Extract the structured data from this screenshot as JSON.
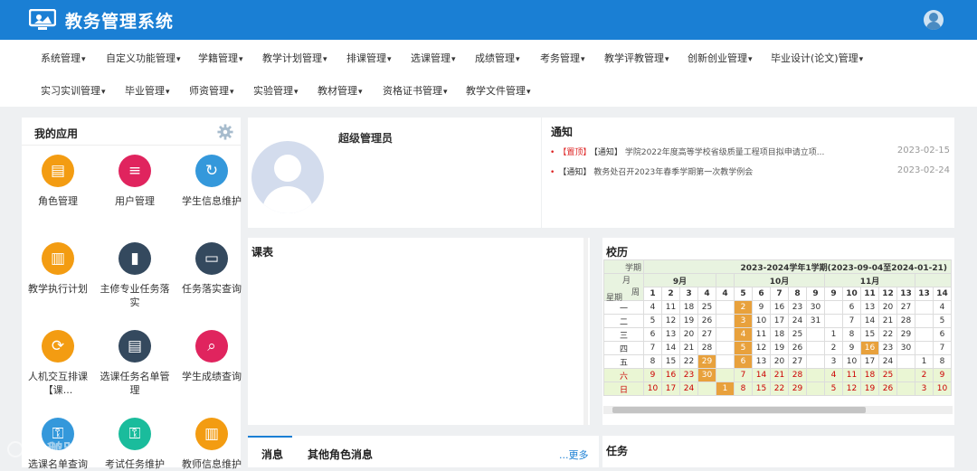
{
  "header": {
    "title": "教务管理系统"
  },
  "menu_row1": [
    "系统管理",
    "自定义功能管理",
    "学籍管理",
    "教学计划管理",
    "排课管理",
    "选课管理",
    "成绩管理",
    "考务管理",
    "教学评教管理",
    "创新创业管理",
    "毕业设计(论文)管理"
  ],
  "menu_row2": [
    "实习实训管理",
    "毕业管理",
    "师资管理",
    "实验管理",
    "教材管理",
    "资格证书管理",
    "教学文件管理"
  ],
  "apps": {
    "title": "我的应用",
    "items": [
      {
        "label": "角色管理",
        "color": "#f39c12",
        "icon": "clipboard-icon"
      },
      {
        "label": "用户管理",
        "color": "#e0245e",
        "icon": "stack-icon"
      },
      {
        "label": "学生信息维护",
        "color": "#3498db",
        "icon": "refresh-user-icon"
      },
      {
        "label": "教学执行计划",
        "color": "#f39c12",
        "icon": "book-icon"
      },
      {
        "label": "主修专业任务落实",
        "color": "#34495e",
        "icon": "bookmark-icon"
      },
      {
        "label": "任务落实查询",
        "color": "#34495e",
        "icon": "camera-icon"
      },
      {
        "label": "人机交互排课【课...",
        "color": "#f39c12",
        "icon": "cycle-icon"
      },
      {
        "label": "选课任务名单管理",
        "color": "#34495e",
        "icon": "document-icon"
      },
      {
        "label": "学生成绩查询",
        "color": "#e0245e",
        "icon": "search-doc-icon"
      },
      {
        "label": "选课名单查询",
        "color": "#3498db",
        "icon": "key-icon"
      },
      {
        "label": "考试任务维护",
        "color": "#1abc9c",
        "icon": "key-icon"
      },
      {
        "label": "教师信息维护",
        "color": "#f39c12",
        "icon": "book-icon"
      }
    ]
  },
  "profile": {
    "name": "超级管理员"
  },
  "notices": {
    "title": "通知",
    "items": [
      {
        "top_tag": "【置顶】",
        "type": "【通知】",
        "title": "学院2022年度高等学校省级质量工程项目拟申请立项...",
        "date": "2023-02-15"
      },
      {
        "top_tag": "",
        "type": "【通知】",
        "title": "教务处召开2023年春季学期第一次教学例会",
        "date": "2023-02-24"
      }
    ]
  },
  "schedule": {
    "title": "课表"
  },
  "calendar": {
    "title": "校历",
    "term": "2023-2024学年1学期(2023-09-04至2024-01-21)",
    "corner": {
      "term": "学期",
      "month": "月",
      "week": "周",
      "weekday": "星期"
    },
    "months": [
      "9月",
      "10月",
      "11月"
    ],
    "weeks": [
      "1",
      "2",
      "3",
      "4",
      "4",
      "5",
      "6",
      "7",
      "8",
      "9",
      "9",
      "10",
      "11",
      "12",
      "13",
      "13",
      "14"
    ],
    "rows": [
      {
        "day": "一",
        "cells": [
          "4",
          "11",
          "18",
          "25",
          "",
          "2",
          "9",
          "16",
          "23",
          "30",
          "",
          "6",
          "13",
          "20",
          "27",
          "",
          "4"
        ]
      },
      {
        "day": "二",
        "cells": [
          "5",
          "12",
          "19",
          "26",
          "",
          "3",
          "10",
          "17",
          "24",
          "31",
          "",
          "7",
          "14",
          "21",
          "28",
          "",
          "5"
        ]
      },
      {
        "day": "三",
        "cells": [
          "6",
          "13",
          "20",
          "27",
          "",
          "4",
          "11",
          "18",
          "25",
          "",
          "1",
          "8",
          "15",
          "22",
          "29",
          "",
          "6"
        ]
      },
      {
        "day": "四",
        "cells": [
          "7",
          "14",
          "21",
          "28",
          "",
          "5",
          "12",
          "19",
          "26",
          "",
          "2",
          "9",
          "16",
          "23",
          "30",
          "",
          "7"
        ]
      },
      {
        "day": "五",
        "cells": [
          "8",
          "15",
          "22",
          "29",
          "",
          "6",
          "13",
          "20",
          "27",
          "",
          "3",
          "10",
          "17",
          "24",
          "",
          "1",
          "8"
        ]
      },
      {
        "day": "六",
        "cells": [
          "9",
          "16",
          "23",
          "30",
          "",
          "7",
          "14",
          "21",
          "28",
          "",
          "4",
          "11",
          "18",
          "25",
          "",
          "2",
          "9"
        ]
      },
      {
        "day": "日",
        "cells": [
          "10",
          "17",
          "24",
          "",
          "1",
          "8",
          "15",
          "22",
          "29",
          "",
          "5",
          "12",
          "19",
          "26",
          "",
          "3",
          "10"
        ]
      }
    ],
    "highlight": [
      [
        0,
        5
      ],
      [
        1,
        5
      ],
      [
        2,
        5
      ],
      [
        3,
        5
      ],
      [
        4,
        3
      ],
      [
        4,
        5
      ],
      [
        5,
        3
      ],
      [
        6,
        4
      ],
      [
        3,
        12
      ]
    ]
  },
  "messages": {
    "tab_active": "消息",
    "tab_other": "其他角色消息",
    "more": "...更多"
  },
  "tasks": {
    "title": "任务"
  },
  "watermark": "小鹅跨境"
}
